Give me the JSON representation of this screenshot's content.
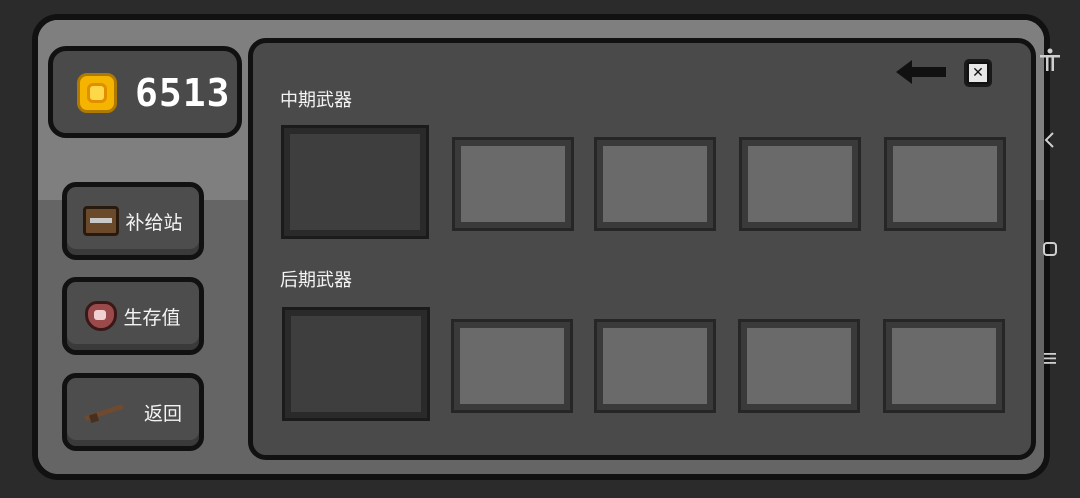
{
  "currency": {
    "icon": "gold-coin-icon",
    "amount": "6513"
  },
  "sidebar": {
    "buttons": [
      {
        "label": "补给站",
        "icon": "treasure-chest-icon"
      },
      {
        "label": "生存值",
        "icon": "bandaged-heart-icon"
      },
      {
        "label": "返回",
        "icon": "rifle-icon"
      }
    ]
  },
  "main": {
    "sections": [
      {
        "title": "中期武器",
        "slots": 5,
        "selected_index": 0
      },
      {
        "title": "后期武器",
        "slots": 5,
        "selected_index": 0
      }
    ],
    "back_icon": "arrow-left-icon",
    "close_icon": "close-icon"
  },
  "system_nav": {
    "icons": [
      "accessibility-icon",
      "back-chevron-icon",
      "home-square-icon",
      "menu-lines-icon"
    ]
  },
  "colors": {
    "coin": "#f5b400",
    "panel": "#4a4a4a",
    "slot": "#6a6a6a",
    "slot_selected": "#3e3e3e"
  }
}
